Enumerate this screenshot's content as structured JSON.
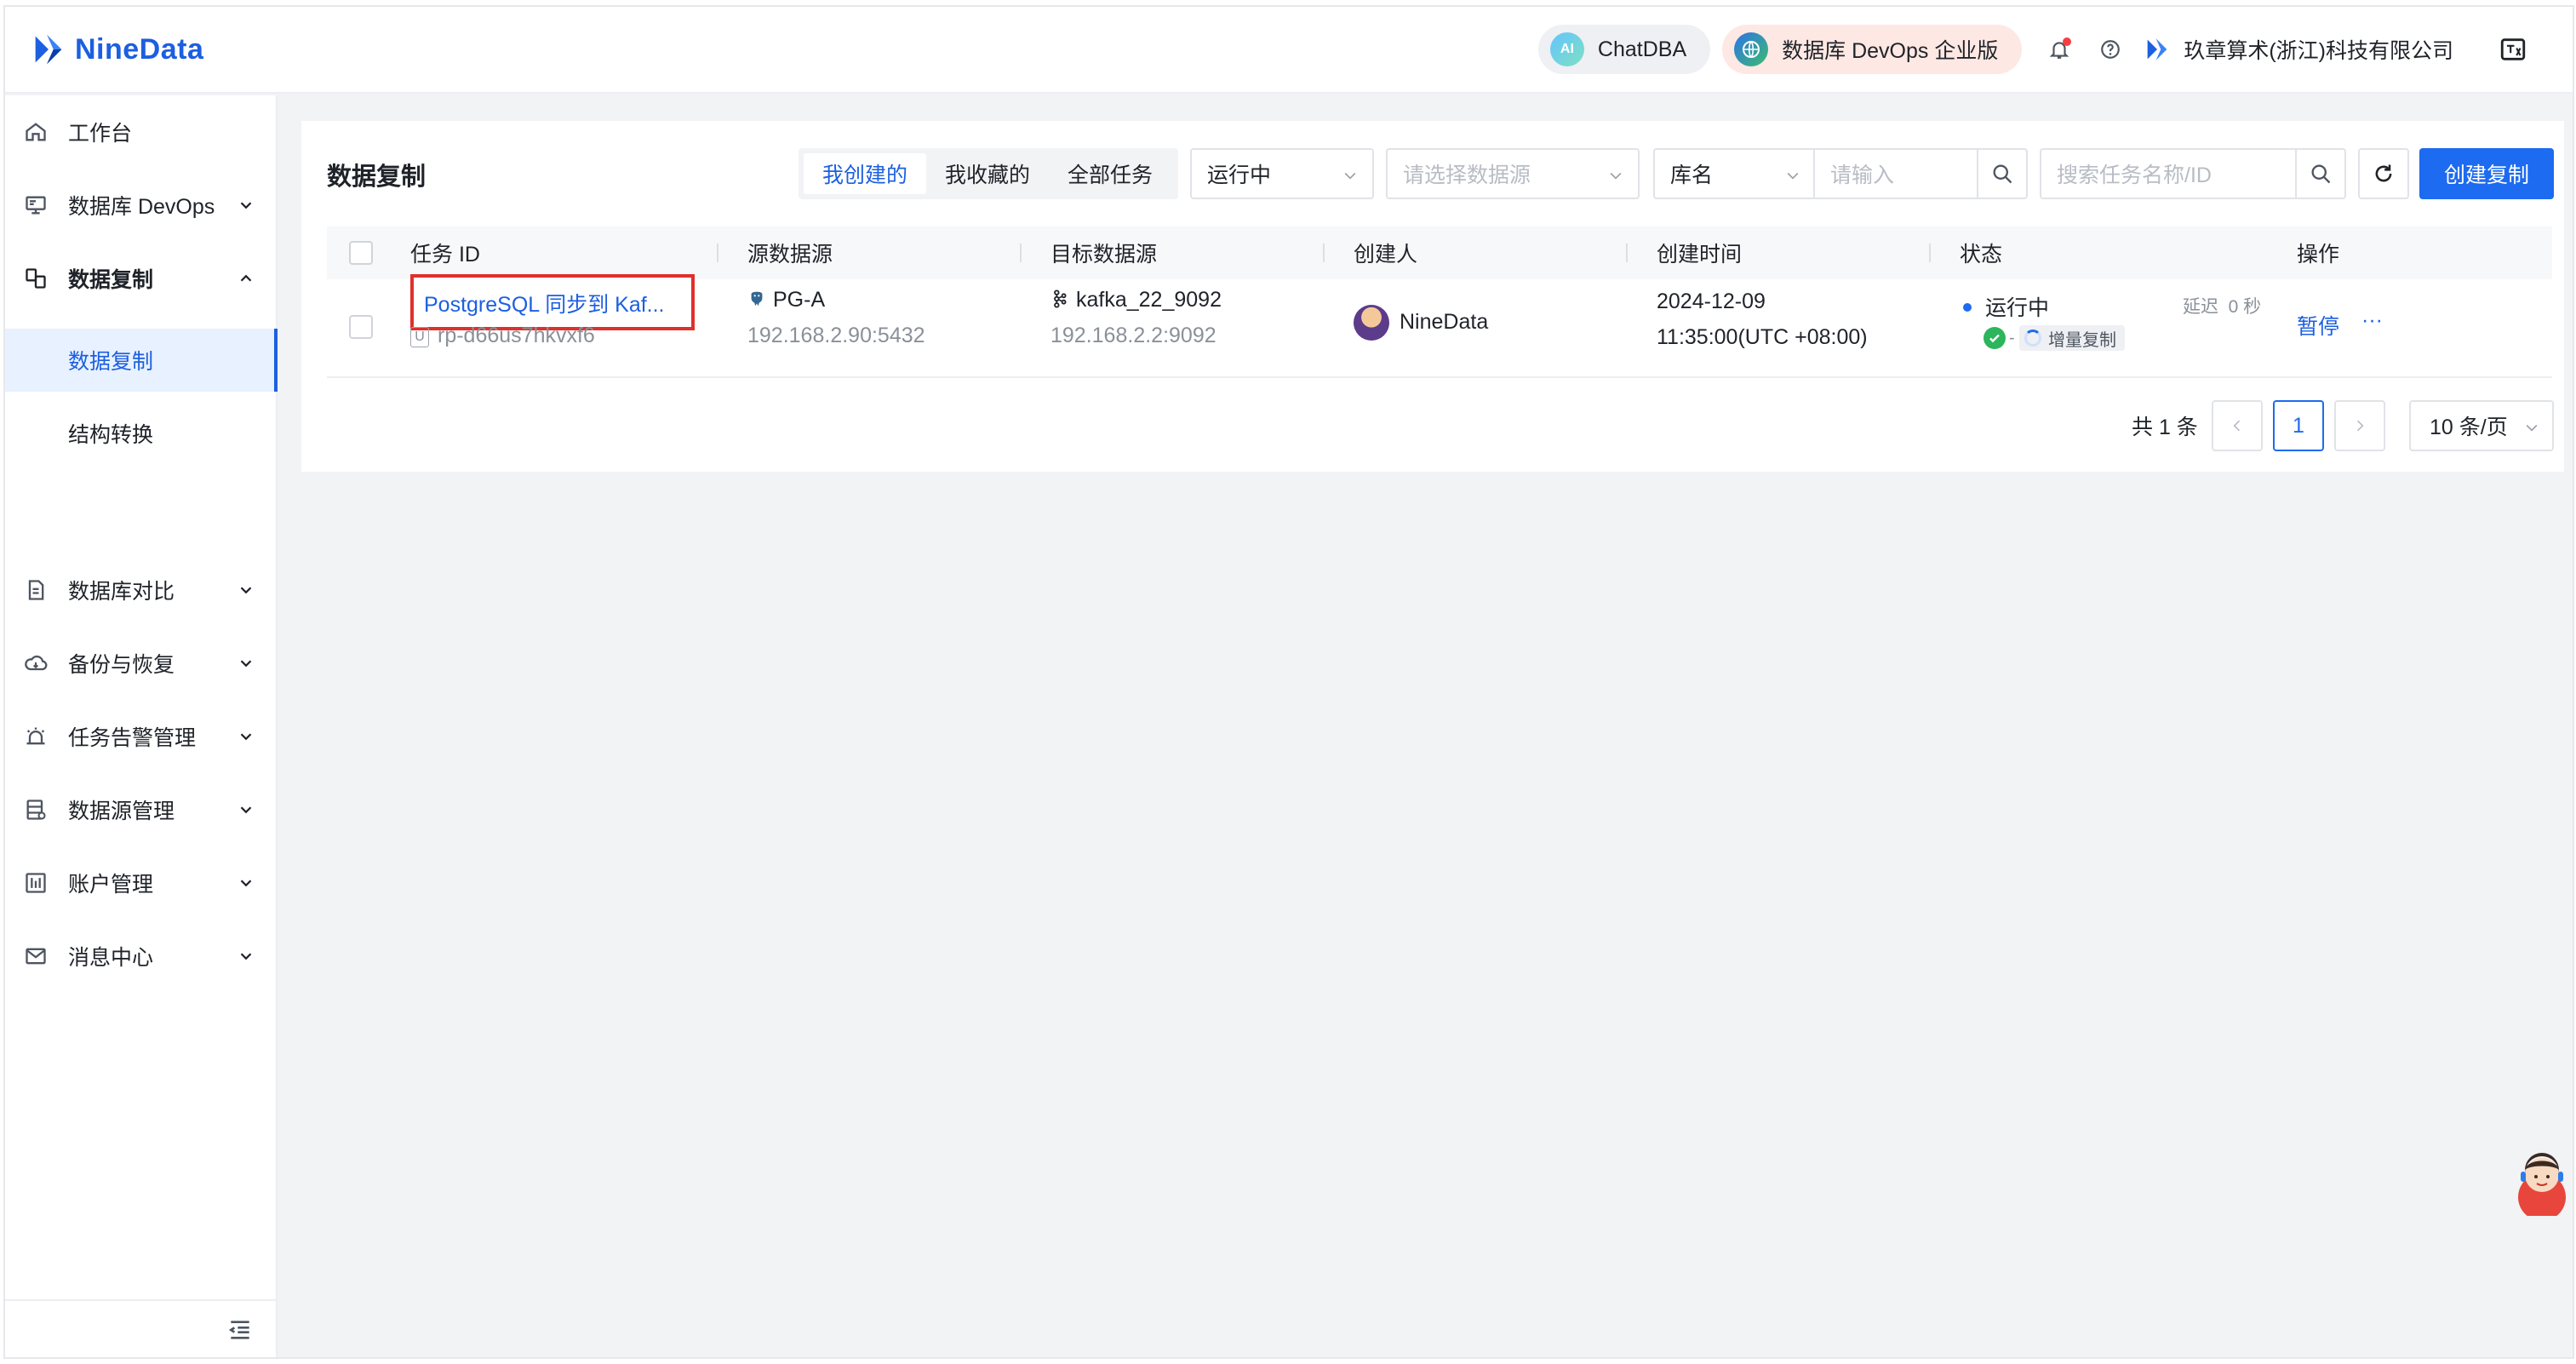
{
  "brand": {
    "name": "NineData"
  },
  "header": {
    "chat_label": "ChatDBA",
    "chat_icon_text": "AI",
    "devops_label": "数据库 DevOps 企业版",
    "company": "玖章算术(浙江)科技有限公司"
  },
  "sidebar": {
    "items": [
      {
        "label": "工作台"
      },
      {
        "label": "数据库 DevOps"
      },
      {
        "label": "数据复制"
      },
      {
        "label": "数据库对比"
      },
      {
        "label": "备份与恢复"
      },
      {
        "label": "任务告警管理"
      },
      {
        "label": "数据源管理"
      },
      {
        "label": "账户管理"
      },
      {
        "label": "消息中心"
      }
    ],
    "sub_items": [
      {
        "label": "数据复制"
      },
      {
        "label": "结构转换"
      }
    ]
  },
  "main": {
    "title": "数据复制",
    "tabs": [
      {
        "label": "我创建的"
      },
      {
        "label": "我收藏的"
      },
      {
        "label": "全部任务"
      }
    ],
    "status_filter": "运行中",
    "datasource_placeholder": "请选择数据源",
    "dbname_select": "库名",
    "dbname_placeholder": "请输入",
    "search_placeholder": "搜索任务名称/ID",
    "create_button": "创建复制"
  },
  "table": {
    "columns": [
      "任务 ID",
      "源数据源",
      "目标数据源",
      "创建人",
      "创建时间",
      "状态",
      "操作"
    ],
    "rows": [
      {
        "task_name": "PostgreSQL 同步到 Kaf...",
        "task_id_tag": "U",
        "task_id": "rp-d66us7hkvxf6",
        "source_name": "PG-A",
        "source_addr": "192.168.2.90:5432",
        "target_name": "kafka_22_9092",
        "target_addr": "192.168.2.2:9092",
        "creator": "NineData",
        "created_date": "2024-12-09",
        "created_time": "11:35:00(UTC +08:00)",
        "status": "运行中",
        "delay_label": "延迟",
        "delay_value": "0 秒",
        "stage": "增量复制",
        "action_pause": "暂停",
        "action_more": "···"
      }
    ]
  },
  "pagination": {
    "total": "共 1 条",
    "current_page": "1",
    "page_size": "10 条/页"
  },
  "colors": {
    "brand": "#1c5fe0",
    "primary": "#1c6bf0",
    "highlight": "#e0302b",
    "success": "#2db55d"
  }
}
